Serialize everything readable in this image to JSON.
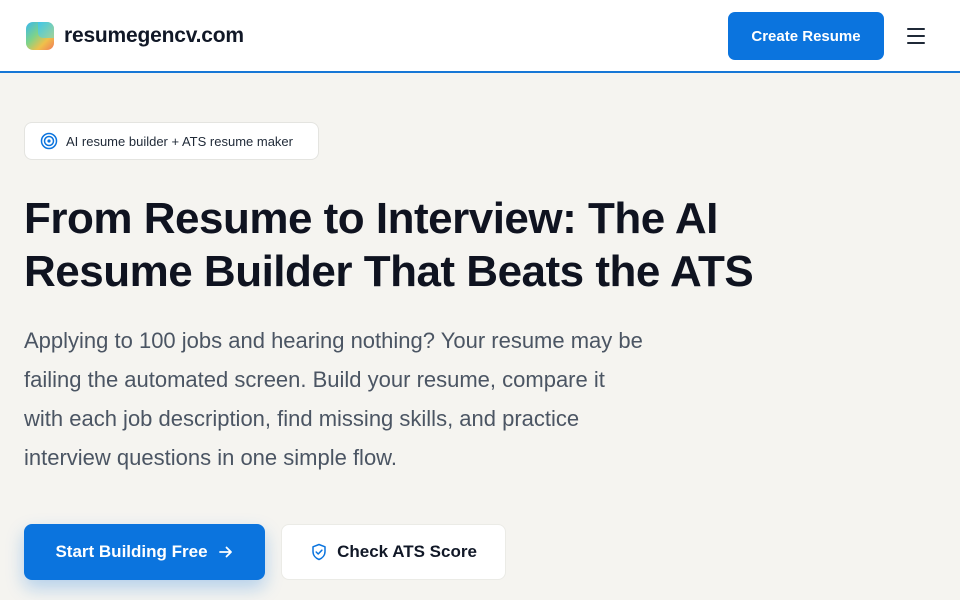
{
  "header": {
    "brand_name": "resumegencv.com",
    "cta_label": "Create Resume",
    "menu_icon": "hamburger-menu-icon"
  },
  "badge": {
    "icon": "target-icon",
    "text": "AI resume builder + ATS resume maker"
  },
  "hero": {
    "headline_line1": "From Resume to Interview: The AI",
    "headline_line2": "Resume Builder That Beats the ATS",
    "subtext_lines": [
      "Applying to 100 jobs and hearing nothing? Your resume may be",
      "failing the automated screen. Build your resume, compare it",
      "with each job description, find missing skills, and practice",
      "interview questions in one simple flow."
    ]
  },
  "actions": {
    "primary_label": "Start Building Free",
    "primary_icon": "arrow-right-icon",
    "secondary_label": "Check ATS Score",
    "secondary_icon": "shield-check-icon"
  },
  "colors": {
    "accent": "#0b74de",
    "background": "#f5f4f0",
    "header_border": "#1677d6"
  }
}
